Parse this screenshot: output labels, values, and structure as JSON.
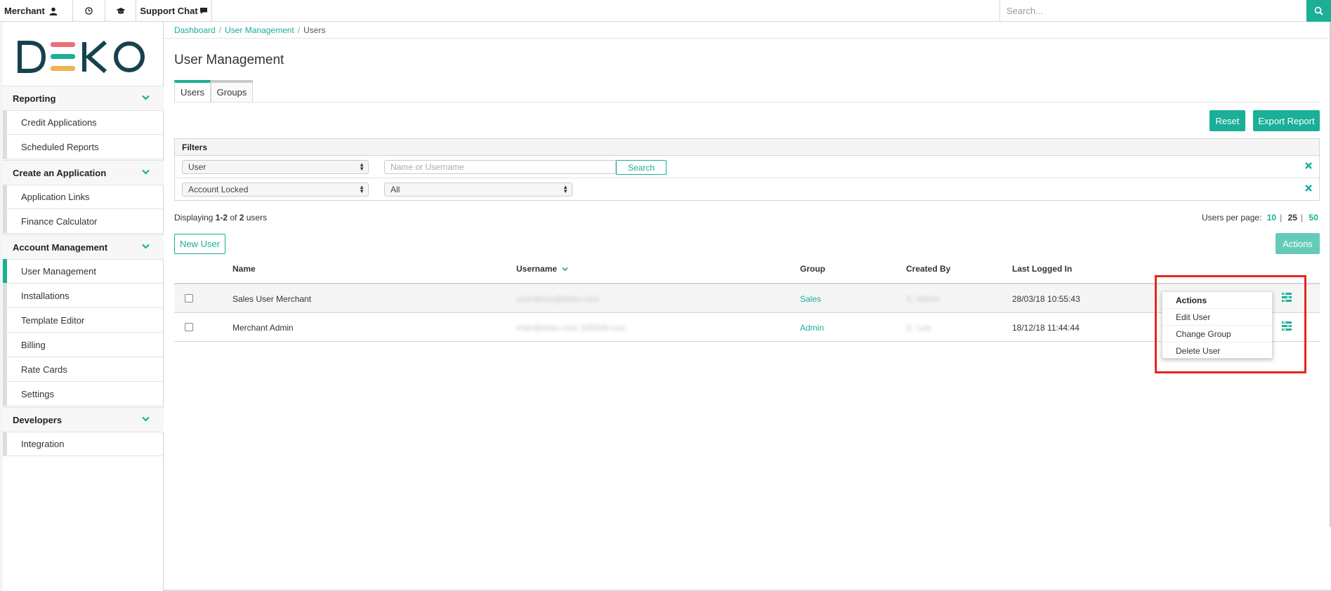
{
  "topbar": {
    "merchant_label": "Merchant",
    "support_label": "Support Chat",
    "search_placeholder": "Search..."
  },
  "sidebar": {
    "logo_text": "DEKO",
    "sections": [
      {
        "label": "Reporting",
        "items": [
          "Credit Applications",
          "Scheduled Reports"
        ]
      },
      {
        "label": "Create an Application",
        "items": [
          "Application Links",
          "Finance Calculator"
        ]
      },
      {
        "label": "Account Management",
        "items": [
          "User Management",
          "Installations",
          "Template Editor",
          "Billing",
          "Rate Cards",
          "Settings"
        ]
      },
      {
        "label": "Developers",
        "items": [
          "Integration"
        ]
      }
    ],
    "active_item": "User Management"
  },
  "breadcrumb": [
    "Dashboard",
    "User Management",
    "Users"
  ],
  "page_title": "User Management",
  "tabs": [
    "Users",
    "Groups"
  ],
  "buttons": {
    "reset": "Reset",
    "export": "Export Report",
    "new_user": "New User",
    "actions": "Actions",
    "search": "Search"
  },
  "filters": {
    "title": "Filters",
    "row1_select": "User",
    "row1_placeholder": "Name or Username",
    "row2_select": "Account Locked",
    "row2_value": "All"
  },
  "displaying": {
    "prefix": "Displaying ",
    "range": "1-2",
    "of": " of ",
    "total": "2",
    "suffix": " users"
  },
  "per_page": {
    "label": "Users per page:",
    "options": [
      "10",
      "25",
      "50"
    ],
    "current": "25"
  },
  "table": {
    "headers": [
      "Name",
      "Username",
      "Group",
      "Created By",
      "Last Logged In"
    ],
    "rows": [
      {
        "name": "Sales User Merchant",
        "username": "userdemo@deko.com",
        "group": "Sales",
        "created_by": "S. Admin",
        "last_logged_in": "28/03/18 10:55:43"
      },
      {
        "name": "Merchant Admin",
        "username": "mae@deko.com.189349.com",
        "group": "Admin",
        "created_by": "D. Lee",
        "last_logged_in": "18/12/18 11:44:44"
      }
    ]
  },
  "dropdown": {
    "header": "Actions",
    "items": [
      "Edit User",
      "Change Group",
      "Delete User"
    ]
  },
  "colors": {
    "accent": "#1aaf96",
    "highlight": "#e8261c"
  }
}
